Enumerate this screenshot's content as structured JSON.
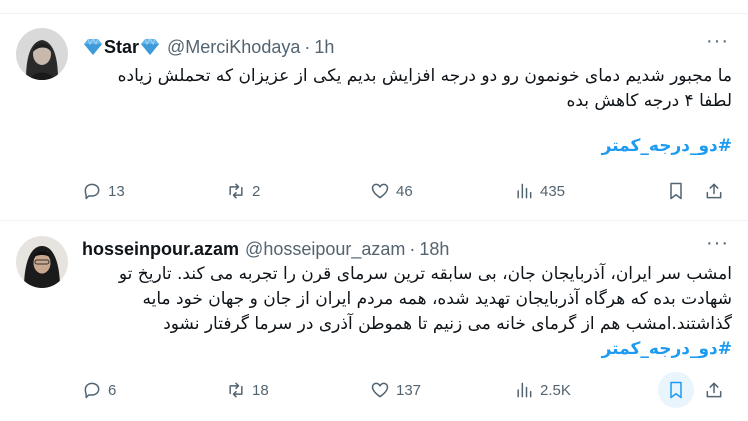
{
  "tweets": [
    {
      "display_name": "Star",
      "handle": "@MerciKhodaya",
      "time": "1h",
      "lines": [
        "ما مجبور شدیم دمای خونمون رو دو درجه افزایش بدیم یکی از عزیزان که تحملش زیاده",
        "لطفا ۴ درجه کاهش بده"
      ],
      "hashtag": "#دو_درجه_کمتر",
      "replies": "13",
      "reposts": "2",
      "likes": "46",
      "views": "435"
    },
    {
      "display_name": "hosseinpour.azam",
      "handle": "@hosseipour_azam",
      "time": "18h",
      "lines": [
        "امشب سر ایران، آذربایجان جان، بی سابقه ترین سرمای قرن را تجربه می کند. تاریخ تو",
        "شهادت بده که هرگاه آذربایجان تهدید شده، همه مردم ایران از جان و جهان خود مایه",
        "گذاشتند.امشب هم از گرمای خانه می زنیم تا هموطن آذری در سرما گرفتار نشود"
      ],
      "hashtag": "#دو_درجه_کمتر",
      "replies": "6",
      "reposts": "18",
      "likes": "137",
      "views": "2.5K"
    }
  ],
  "icons": {
    "name_emoji": "gem-icon",
    "reply": "reply-icon",
    "repost": "repost-icon",
    "like": "heart-icon",
    "views": "views-icon",
    "bookmark": "bookmark-icon",
    "share": "share-icon",
    "more": "more-icon"
  },
  "colors": {
    "accent": "#1d9bf0",
    "text": "#0f1419",
    "muted": "#536471",
    "divider": "#eff3f4",
    "bookmark_bg": "#e8f5fd"
  }
}
